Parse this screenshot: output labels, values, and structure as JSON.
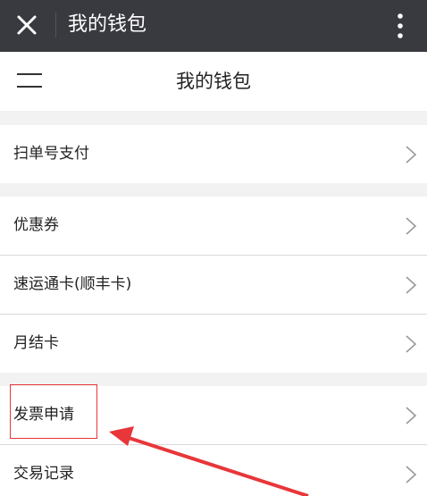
{
  "topbar": {
    "title": "我的钱包",
    "close_icon": "close-icon",
    "more_icon": "more-vertical-icon",
    "bg_color": "#393a3f"
  },
  "navbar": {
    "title": "我的钱包",
    "menu_icon": "hamburger-menu-icon"
  },
  "items": [
    {
      "label": "扫单号支付"
    },
    {
      "label": "优惠券"
    },
    {
      "label": "速运通卡(顺丰卡)"
    },
    {
      "label": "月结卡"
    },
    {
      "label": "发票申请"
    },
    {
      "label": "交易记录"
    }
  ],
  "annotation": {
    "highlight_color": "#e8363a",
    "highlighted_item": "发票申请"
  }
}
